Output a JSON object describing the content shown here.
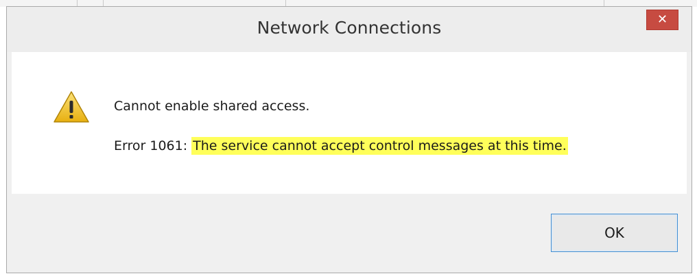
{
  "dialog": {
    "title": "Network Connections",
    "close_label": "✕",
    "icon": "warning-icon",
    "message": "Cannot enable shared access.",
    "error_prefix": "Error 1061:",
    "error_text": "The service cannot accept control messages at this time.",
    "ok_label": "OK"
  },
  "colors": {
    "close_button": "#c74b41",
    "highlight": "#ffff5a",
    "ok_border": "#3c8ed8",
    "warning": "#f2c21b"
  }
}
